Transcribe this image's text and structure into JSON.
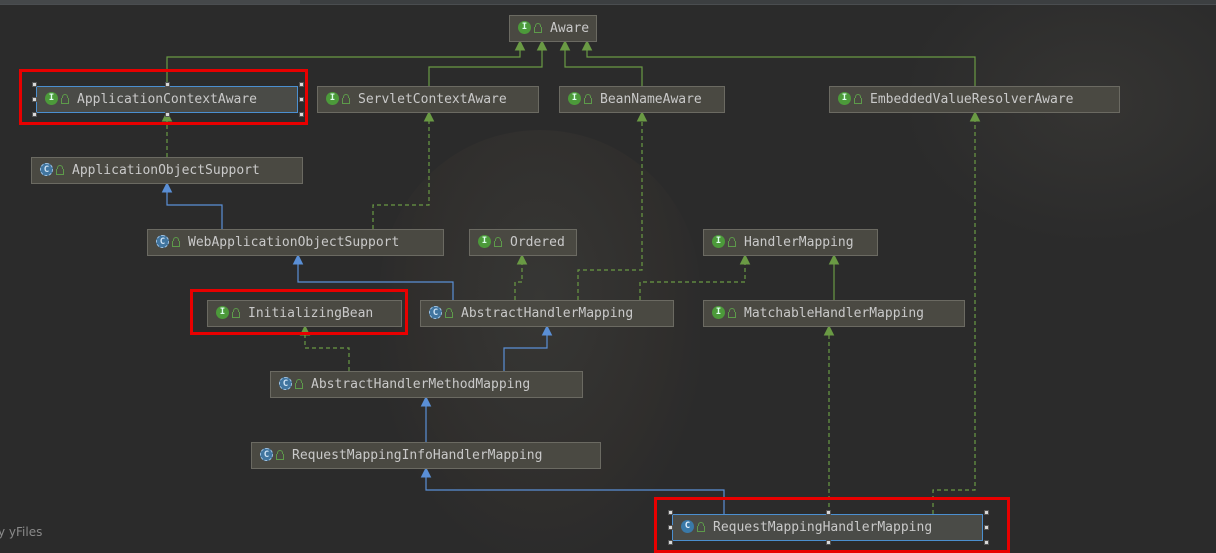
{
  "nodes": [
    {
      "id": "aware",
      "label": "Aware",
      "kind": "interface",
      "icon": "I"
    },
    {
      "id": "appctx",
      "label": "ApplicationContextAware",
      "kind": "interface",
      "icon": "I"
    },
    {
      "id": "servletctx",
      "label": "ServletContextAware",
      "kind": "interface",
      "icon": "I"
    },
    {
      "id": "beanname",
      "label": "BeanNameAware",
      "kind": "interface",
      "icon": "I"
    },
    {
      "id": "embedded",
      "label": "EmbeddedValueResolverAware",
      "kind": "interface",
      "icon": "I"
    },
    {
      "id": "appobj",
      "label": "ApplicationObjectSupport",
      "kind": "abstract",
      "icon": "C"
    },
    {
      "id": "webappobj",
      "label": "WebApplicationObjectSupport",
      "kind": "abstract",
      "icon": "C"
    },
    {
      "id": "ordered",
      "label": "Ordered",
      "kind": "interface",
      "icon": "I"
    },
    {
      "id": "handlermapping",
      "label": "HandlerMapping",
      "kind": "interface",
      "icon": "I"
    },
    {
      "id": "initbean",
      "label": "InitializingBean",
      "kind": "interface",
      "icon": "I"
    },
    {
      "id": "abshm",
      "label": "AbstractHandlerMapping",
      "kind": "abstract",
      "icon": "C"
    },
    {
      "id": "matchable",
      "label": "MatchableHandlerMapping",
      "kind": "interface",
      "icon": "I"
    },
    {
      "id": "abshmm",
      "label": "AbstractHandlerMethodMapping",
      "kind": "abstract",
      "icon": "C"
    },
    {
      "id": "rmihm",
      "label": "RequestMappingInfoHandlerMapping",
      "kind": "abstract",
      "icon": "C"
    },
    {
      "id": "rmhm",
      "label": "RequestMappingHandlerMapping",
      "kind": "class",
      "icon": "C"
    }
  ],
  "edges": [
    {
      "from": "appctx",
      "to": "aware",
      "type": "extends-interface"
    },
    {
      "from": "servletctx",
      "to": "aware",
      "type": "extends-interface"
    },
    {
      "from": "beanname",
      "to": "aware",
      "type": "extends-interface"
    },
    {
      "from": "embedded",
      "to": "aware",
      "type": "extends-interface"
    },
    {
      "from": "appobj",
      "to": "appctx",
      "type": "implements"
    },
    {
      "from": "webappobj",
      "to": "appobj",
      "type": "extends"
    },
    {
      "from": "webappobj",
      "to": "servletctx",
      "type": "implements"
    },
    {
      "from": "abshm",
      "to": "webappobj",
      "type": "extends"
    },
    {
      "from": "abshm",
      "to": "ordered",
      "type": "implements"
    },
    {
      "from": "abshm",
      "to": "beanname",
      "type": "implements"
    },
    {
      "from": "abshm",
      "to": "handlermapping",
      "type": "implements"
    },
    {
      "from": "matchable",
      "to": "handlermapping",
      "type": "extends-interface"
    },
    {
      "from": "abshmm",
      "to": "initbean",
      "type": "implements"
    },
    {
      "from": "abshmm",
      "to": "abshm",
      "type": "extends"
    },
    {
      "from": "rmihm",
      "to": "abshmm",
      "type": "extends"
    },
    {
      "from": "rmhm",
      "to": "rmihm",
      "type": "extends"
    },
    {
      "from": "rmhm",
      "to": "matchable",
      "type": "implements"
    },
    {
      "from": "rmhm",
      "to": "embedded",
      "type": "implements"
    }
  ],
  "highlighted": [
    "appctx",
    "initbean",
    "rmhm"
  ],
  "selected": [
    "appctx",
    "rmhm"
  ],
  "watermark": "y yFiles",
  "colors": {
    "background": "#2b2b2b",
    "node_fill": "#4a4942",
    "interface_edge": "#6a9a44",
    "class_edge": "#5a8fd6",
    "highlight": "#e80000",
    "selection": "#4b8fd0"
  }
}
